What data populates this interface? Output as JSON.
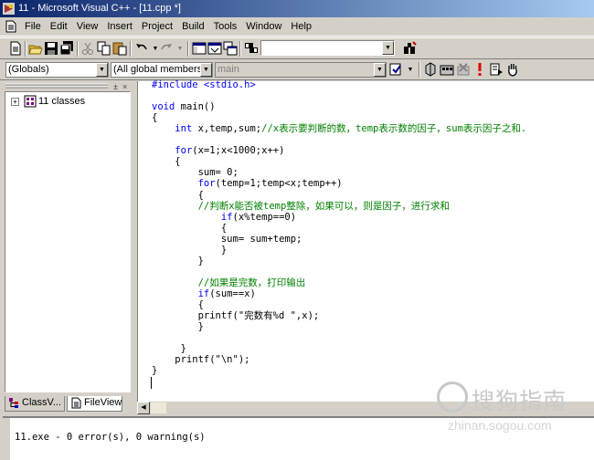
{
  "window": {
    "title": "11 - Microsoft Visual C++ - [11.cpp *]"
  },
  "menu": [
    "File",
    "Edit",
    "View",
    "Insert",
    "Project",
    "Build",
    "Tools",
    "Window",
    "Help"
  ],
  "toolbar": {
    "icons": [
      "new-text-file-icon",
      "open-icon",
      "save-icon",
      "save-all-icon",
      "cut-icon",
      "copy-icon",
      "paste-icon",
      "undo-icon",
      "redo-icon",
      "workspace-icon",
      "output-icon",
      "window-list-icon",
      "find-in-files-icon",
      "find-icon"
    ],
    "find_value": ""
  },
  "wizardbar": {
    "class_combo": "(Globals)",
    "filter_combo": "(All global members",
    "member_combo": "main",
    "icons": [
      "action-icon",
      "compile-icon",
      "build-icon",
      "stop-build-icon",
      "execute-icon",
      "go-icon",
      "insert-breakpoint-icon",
      "hand-icon"
    ]
  },
  "workspace": {
    "tree_expander": "+",
    "tree_root": "11 classes",
    "tabs": [
      {
        "label": "ClassV...",
        "icon": "class-view-icon"
      },
      {
        "label": "FileView",
        "icon": "file-view-icon"
      }
    ]
  },
  "code": [
    [
      {
        "t": "#include <stdio.h>",
        "c": "kw"
      }
    ],
    [],
    [
      {
        "t": "void",
        "c": "kw"
      },
      {
        "t": " main()",
        "c": ""
      }
    ],
    [
      {
        "t": "{",
        "c": ""
      }
    ],
    [
      {
        "t": "    ",
        "c": ""
      },
      {
        "t": "int",
        "c": "kw"
      },
      {
        "t": " x,temp,sum;",
        "c": ""
      },
      {
        "t": "//x表示要判断的数，temp表示数的因子，sum表示因子之和.",
        "c": "cm"
      }
    ],
    [],
    [
      {
        "t": "    ",
        "c": ""
      },
      {
        "t": "for",
        "c": "kw"
      },
      {
        "t": "(x=1;x<1000;x++)",
        "c": ""
      }
    ],
    [
      {
        "t": "    {",
        "c": ""
      }
    ],
    [
      {
        "t": "        sum= 0;",
        "c": ""
      }
    ],
    [
      {
        "t": "        ",
        "c": ""
      },
      {
        "t": "for",
        "c": "kw"
      },
      {
        "t": "(temp=1;temp<x;temp++)",
        "c": ""
      }
    ],
    [
      {
        "t": "        {",
        "c": ""
      }
    ],
    [
      {
        "t": "        ",
        "c": ""
      },
      {
        "t": "//判断x能否被temp整除，如果可以，则是因子，进行求和",
        "c": "cm"
      }
    ],
    [
      {
        "t": "            ",
        "c": ""
      },
      {
        "t": "if",
        "c": "kw"
      },
      {
        "t": "(x%temp==0)",
        "c": ""
      }
    ],
    [
      {
        "t": "            {",
        "c": ""
      }
    ],
    [
      {
        "t": "            sum= sum+temp;",
        "c": ""
      }
    ],
    [
      {
        "t": "            }",
        "c": ""
      }
    ],
    [
      {
        "t": "        }",
        "c": ""
      }
    ],
    [],
    [
      {
        "t": "        ",
        "c": ""
      },
      {
        "t": "//如果是完数，打印输出",
        "c": "cm"
      }
    ],
    [
      {
        "t": "        ",
        "c": ""
      },
      {
        "t": "if",
        "c": "kw"
      },
      {
        "t": "(sum==x)",
        "c": ""
      }
    ],
    [
      {
        "t": "        {",
        "c": ""
      }
    ],
    [
      {
        "t": "        printf(\"完数有%d \",x);",
        "c": ""
      }
    ],
    [
      {
        "t": "        }",
        "c": ""
      }
    ],
    [],
    [
      {
        "t": "     }",
        "c": ""
      }
    ],
    [
      {
        "t": "    printf(\"\\n\");",
        "c": ""
      }
    ],
    [
      {
        "t": "}",
        "c": ""
      }
    ]
  ],
  "output": {
    "text": "11.exe - 0 error(s), 0 warning(s)"
  },
  "watermark": {
    "text": "搜狗指南",
    "url": "zhinan.sogou.com"
  }
}
